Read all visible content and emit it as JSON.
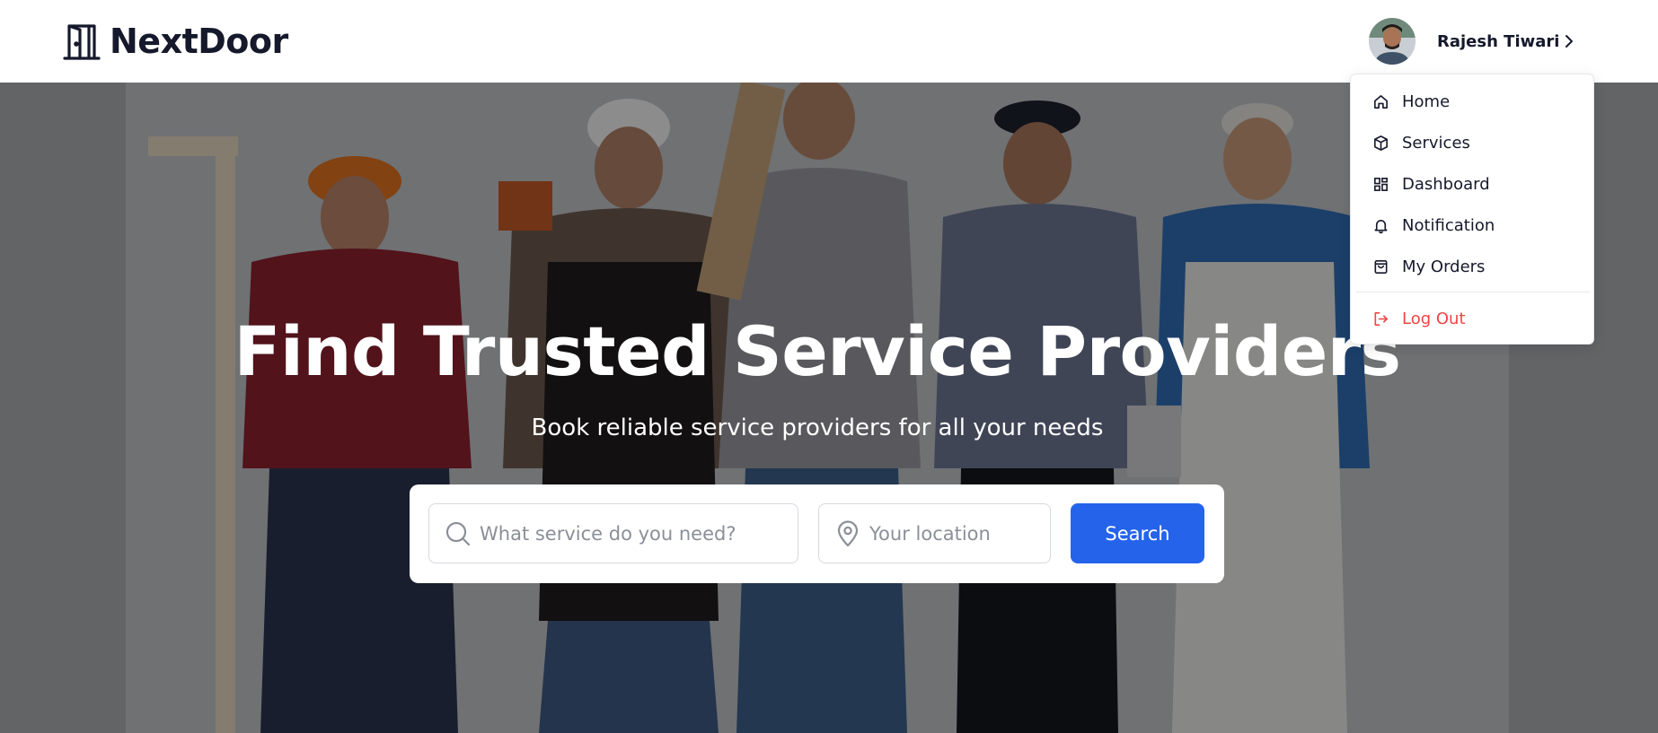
{
  "app": {
    "brand": "NextDoor",
    "user_name": "Rajesh Tiwari"
  },
  "hero": {
    "title": "Find Trusted Service Providers",
    "subtitle": "Book reliable service providers for all your needs"
  },
  "search": {
    "service_placeholder": "What service do you need?",
    "service_value": "",
    "location_placeholder": "Your location",
    "location_value": "",
    "button_label": "Search"
  },
  "menu": {
    "items": [
      {
        "label": "Home",
        "icon": "home-icon"
      },
      {
        "label": "Services",
        "icon": "box-icon"
      },
      {
        "label": "Dashboard",
        "icon": "grid-icon"
      },
      {
        "label": "Notification",
        "icon": "bell-icon"
      },
      {
        "label": "My Orders",
        "icon": "shopping-bag-icon"
      }
    ],
    "logout_label": "Log Out",
    "logout_icon": "logout-icon"
  },
  "colors": {
    "primary": "#2563eb",
    "danger": "#ef4444",
    "text_dark": "#15192b"
  }
}
